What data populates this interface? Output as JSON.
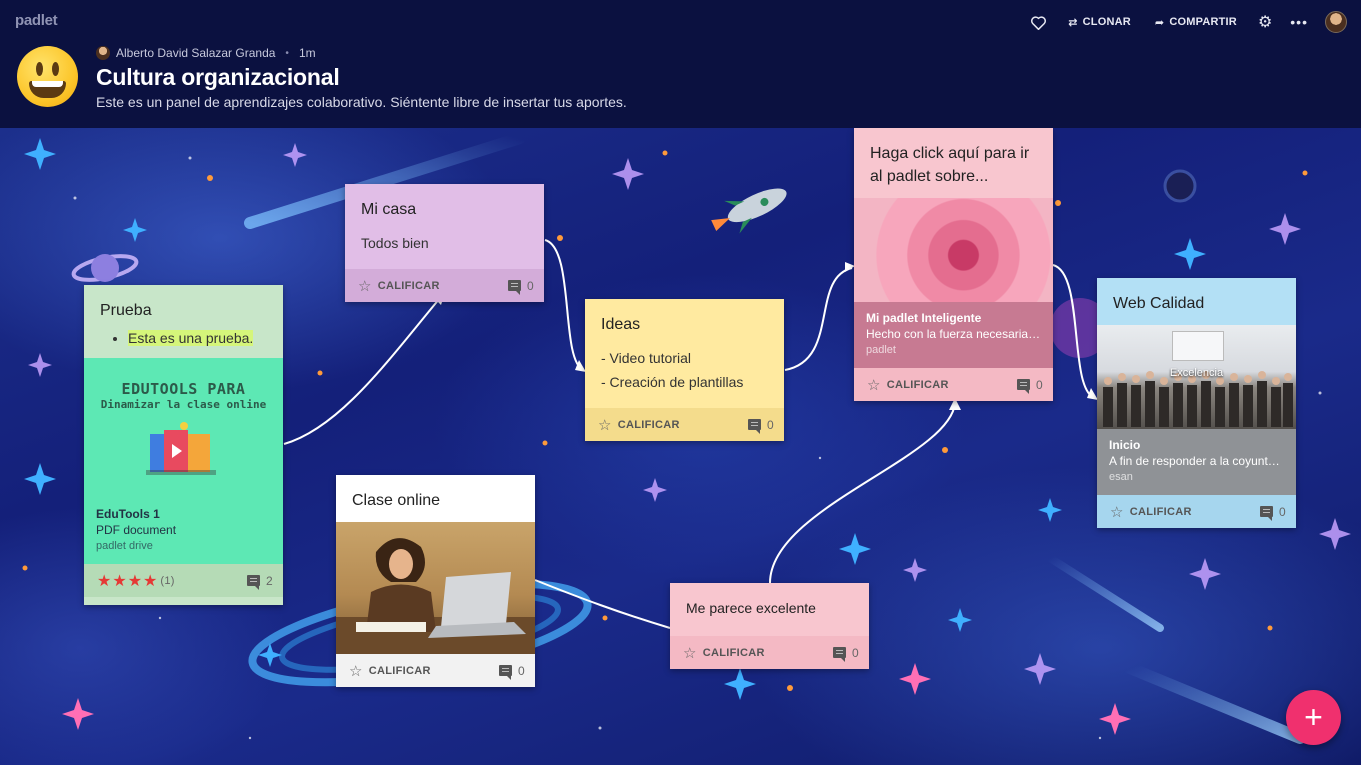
{
  "app": {
    "brand": "padlet"
  },
  "toolbar": {
    "like_icon": "heart-icon",
    "clone_label": "CLONAR",
    "share_label": "COMPARTIR",
    "settings_icon": "gear-icon",
    "more_icon": "more-icon"
  },
  "board": {
    "author": "Alberto David Salazar Granda",
    "time": "1m",
    "title": "Cultura organizacional",
    "description": "Este es un panel de aprendizajes colaborativo. Siéntente libre de insertar tus aportes."
  },
  "posts": {
    "prueba": {
      "title": "Prueba",
      "bullet": "Esta es una prueba.",
      "thumb_line1": "EDUTOOLS PARA",
      "thumb_line2": "Dinamizar la clase online",
      "att_title": "EduTools 1",
      "att_sub": "PDF document",
      "att_src": "padlet drive",
      "rating": "★★★★",
      "rating_count": "(1)",
      "comments": "2",
      "color": "#c8e6c9"
    },
    "mi_casa": {
      "title": "Mi casa",
      "body": "Todos bien",
      "rate_label": "CALIFICAR",
      "comments": "0",
      "color": "#e1bee7"
    },
    "ideas": {
      "title": "Ideas",
      "line1": "- Video tutorial",
      "line2": "- Creación de plantillas",
      "rate_label": "CALIFICAR",
      "comments": "0",
      "color": "#ffeaa0"
    },
    "haga_click": {
      "title": "Haga click aquí para ir al padlet sobre...",
      "att_title": "Mi padlet Inteligente",
      "att_sub": "Hecho con la fuerza necesaria ...",
      "att_src": "padlet",
      "rate_label": "CALIFICAR",
      "comments": "0",
      "color": "#f8c6cf"
    },
    "web_calidad": {
      "title": "Web Calidad",
      "image_caption": "Excelencia",
      "att_title": "Inicio",
      "att_sub": "A fin de responder a la coyuntu...",
      "att_src": "esan",
      "rate_label": "CALIFICAR",
      "comments": "0",
      "color": "#b3e0f5"
    },
    "clase_online": {
      "title": "Clase online",
      "rate_label": "CALIFICAR",
      "comments": "0",
      "color": "#ffffff"
    },
    "me_parece": {
      "title": "Me parece excelente",
      "rate_label": "CALIFICAR",
      "comments": "0",
      "color": "#f8c6cf"
    }
  },
  "fab": {
    "icon": "plus-icon",
    "label": "+"
  },
  "colors": {
    "fab": "#f0306e",
    "header": "#0b1140",
    "star": "#e53935"
  }
}
